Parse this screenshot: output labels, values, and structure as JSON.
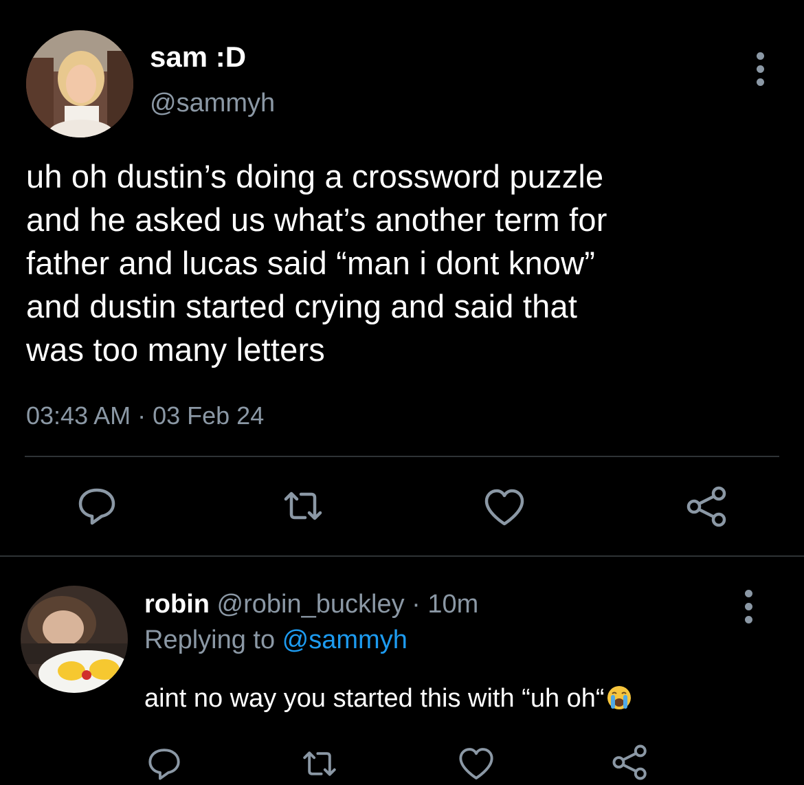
{
  "main_tweet": {
    "display_name": "sam :D",
    "handle": "@sammyh",
    "text": "uh oh dustin’s doing a crossword puzzle\nand he asked us what’s another term for\nfather and lucas said “man i dont know”\nand dustin started crying and said that\nwas too many letters",
    "timestamp": "03:43 AM · 03 Feb 24",
    "actions": [
      "reply-icon",
      "retweet-icon",
      "like-icon",
      "share-icon"
    ]
  },
  "reply_tweet": {
    "display_name": "robin",
    "handle": "@robin_buckley",
    "separator": "·",
    "time": "10m",
    "replying_prefix": "Replying to ",
    "replying_to": "@sammyh",
    "text": "aint no way you started this with “uh oh“",
    "emoji": "loudly-crying-face",
    "actions": [
      "reply-icon",
      "retweet-icon",
      "like-icon",
      "share-icon"
    ]
  },
  "colors": {
    "background": "#000000",
    "primary_text": "#ffffff",
    "secondary_text": "#8b98a5",
    "link": "#1d9bf0",
    "divider": "#2f3336"
  }
}
